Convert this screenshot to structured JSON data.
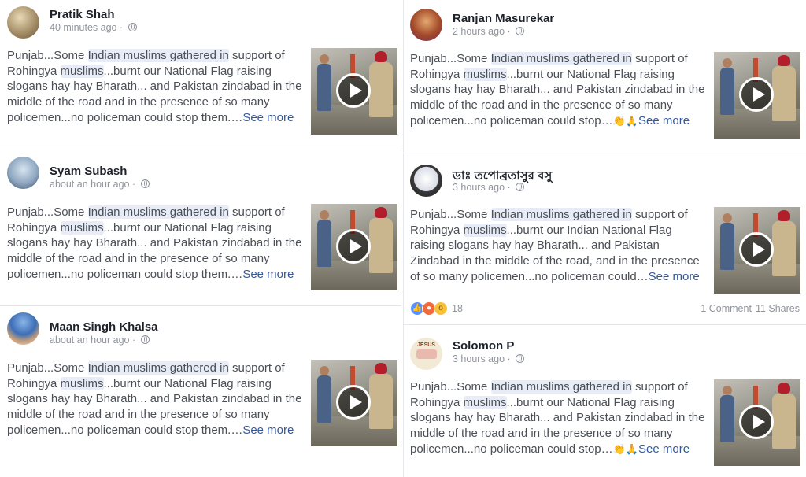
{
  "posts": [
    {
      "name": "Pratik Shah",
      "time": "40 minutes ago",
      "text_a": "Punjab...Some ",
      "hl1": "Indian muslims gathered in",
      "text_b": " support of Rohingya ",
      "hl2": "muslims",
      "text_c": "...burnt our National Flag raising slogans hay hay Bharath... and Pakistan zindabad in the middle of the road and in the presence of so many policemen...no policeman could stop them.…",
      "emoji": "",
      "see_more": "See more"
    },
    {
      "name": "Syam Subash",
      "time": "about an hour ago",
      "text_a": "Punjab...Some ",
      "hl1": "Indian muslims gathered in",
      "text_b": " support of Rohingya ",
      "hl2": "muslims",
      "text_c": "...burnt our National Flag raising slogans hay hay Bharath... and Pakistan zindabad in the middle of the road and in the presence of so many policemen...no policeman could stop them.…",
      "emoji": "",
      "see_more": "See more"
    },
    {
      "name": "Maan Singh Khalsa",
      "time": "about an hour ago",
      "text_a": "Punjab...Some ",
      "hl1": "Indian muslims gathered in",
      "text_b": " support of Rohingya ",
      "hl2": "muslims",
      "text_c": "...burnt our National Flag raising slogans hay hay Bharath... and Pakistan zindabad in the middle of the road and in the presence of so many policemen...no policeman could stop them.…",
      "emoji": "",
      "see_more": "See more"
    },
    {
      "name": "Ranjan Masurekar",
      "time": "2 hours ago",
      "text_a": "Punjab...Some ",
      "hl1": "Indian muslims gathered in",
      "text_b": " support of Rohingya ",
      "hl2": "muslims",
      "text_c": "...burnt our National Flag raising slogans hay hay Bharath... and Pakistan zindabad in the middle of the road and in the presence of so many policemen...no policeman could stop…",
      "emoji": "👏🙏",
      "see_more": "See more"
    },
    {
      "name": "ডাঃ তপোব্রতাসুর বসু",
      "time": "3 hours ago",
      "text_a": "Punjab...Some ",
      "hl1": "Indian muslims gathered in",
      "text_b": " support of Rohingya ",
      "hl2": "muslims",
      "text_c": "...burnt our Indian National Flag raising slogans hay hay Bharath... and Pakistan Zindabad in the middle of the road, and in the presence of so many policemen...no policeman could…",
      "emoji": "",
      "see_more": "See more",
      "reaction_count": "18",
      "comments": "1 Comment",
      "shares": "11 Shares"
    },
    {
      "name": "Solomon P",
      "time": "3 hours ago",
      "text_a": "Punjab...Some ",
      "hl1": "Indian muslims gathered in",
      "text_b": " support of Rohingya ",
      "hl2": "muslims",
      "text_c": "...burnt our National Flag raising slogans hay hay Bharath... and Pakistan zindabad in the middle of the road and in the presence of so many policemen...no policeman could stop…",
      "emoji": "👏🙏",
      "see_more": "See more"
    }
  ],
  "avatar_text": "JESUS",
  "colors": {
    "link": "#365899",
    "highlight": "#e8ecf6",
    "text": "#4b4f56",
    "meta": "#90949c",
    "name": "#1d2129"
  }
}
